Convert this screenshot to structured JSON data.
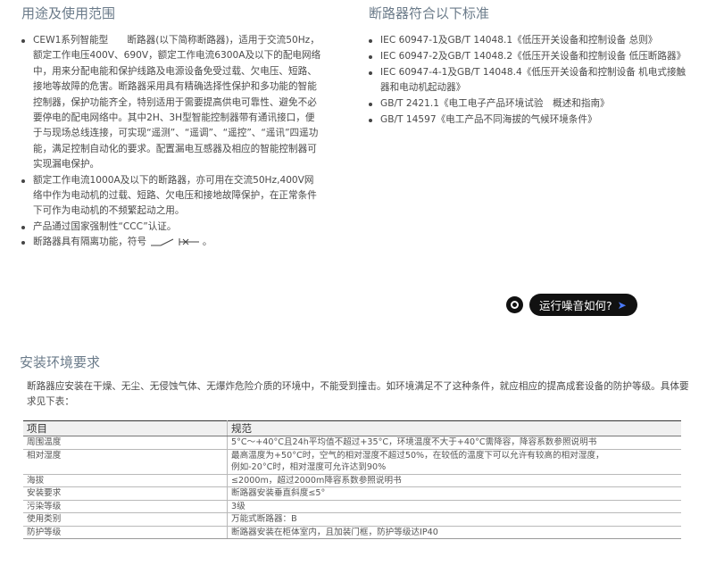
{
  "sections": {
    "usage_title": "用途及使用范围",
    "standards_title": "断路器符合以下标准",
    "install_title": "安装环境要求"
  },
  "usage_items": [
    "CEW1系列智能型　　断路器(以下简称断路器)，适用于交流50Hz，额定工作电压400V、690V，额定工作电流6300A及以下的配电网络中，用来分配电能和保护线路及电源设备免受过载、欠电压、短路、接地等故障的危害。断路器采用具有精确选择性保护和多功能的智能控制器，保护功能齐全，特别适用于需要提高供电可靠性、避免不必要停电的配电网络中。其中2H、3H型智能控制器带有通讯接口，便于与现场总线连接，可实现“遥测”、“遥调”、“遥控”、“遥讯”四遥功能，满足控制自动化的要求。配置漏电互感器及相应的智能控制器可实现漏电保护。",
    "额定工作电流1000A及以下的断路器，亦可用在交流50Hz,400V网络中作为电动机的过载、短路、欠电压和接地故障保护，在正常条件下可作为电动机的不频繁起动之用。",
    "产品通过国家强制性“CCC”认证。"
  ],
  "isolation_text_before": "断路器具有隔离功能，符号",
  "isolation_text_after": "。",
  "standards_items": [
    "IEC 60947-1及GB/T 14048.1《低压开关设备和控制设备 总则》",
    "IEC 60947-2及GB/T 14048.2《低压开关设备和控制设备 低压断路器》",
    "IEC 60947-4-1及GB/T 14048.4《低压开关设备和控制设备 机电式接触器和电动机起动器》",
    "GB/T 2421.1《电工电子产品环境试验　概述和指南》",
    "GB/T 14597《电工产品不同海拔的气候环境条件》"
  ],
  "noise_button_label": "运行噪音如何?",
  "install_paragraph": "断路器应安装在干燥、无尘、无侵蚀气体、无爆炸危险介质的环境中，不能受到撞击。如环境满足不了这种条件，就应相应的提高成套设备的防护等级。具体要求见下表：",
  "table": {
    "headers": [
      "项目",
      "规范"
    ],
    "rows": [
      [
        "周围温度",
        "5°C～+40°C且24h平均值不超过+35°C，环境温度不大于+40°C需降容，降容系数参照说明书"
      ],
      [
        "相对湿度",
        "最高温度为+50°C时，空气的相对湿度不超过50%，在较低的温度下可以允许有较高的相对湿度，\n例如-20°C时，相对湿度可允许达到90%"
      ],
      [
        "海拔",
        "≤2000m，超过2000m降容系数参照说明书"
      ],
      [
        "安装要求",
        "断路器安装垂直斜度≤5°"
      ],
      [
        "污染等级",
        "3级"
      ],
      [
        "使用类别",
        "万能式断路器：B"
      ],
      [
        "防护等级",
        "断路器安装在柜体室内，且加装门框，防护等级达IP40"
      ]
    ]
  },
  "colors": {
    "heading": "#6b7b8a",
    "pill_bg": "#111111",
    "arrow": "#4b7bff"
  }
}
